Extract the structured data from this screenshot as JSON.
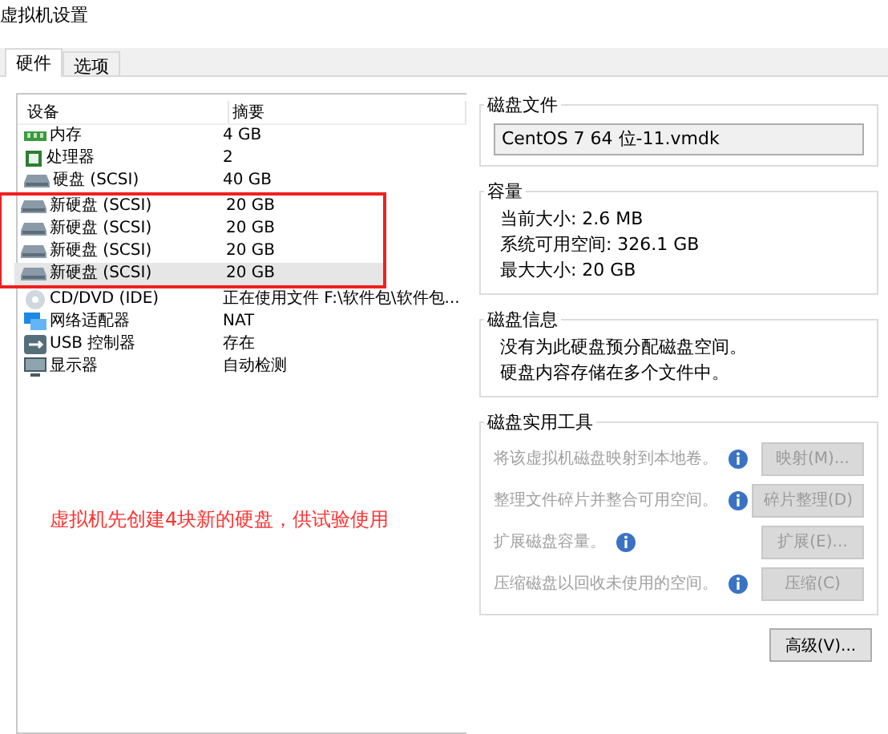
{
  "window": {
    "title": "虚拟机设置"
  },
  "tabs": [
    {
      "label": "硬件",
      "selected": true
    },
    {
      "label": "选项",
      "selected": false
    }
  ],
  "devices": {
    "columns": [
      "设备",
      "摘要"
    ],
    "rows": [
      {
        "kind": "memory",
        "name": "内存",
        "summary": "4 GB",
        "selected": false,
        "marked": false
      },
      {
        "kind": "cpu",
        "name": "处理器",
        "summary": "2",
        "selected": false,
        "marked": false
      },
      {
        "kind": "disk",
        "name": "硬盘 (SCSI)",
        "summary": "40 GB",
        "selected": false,
        "marked": false
      },
      {
        "kind": "disk",
        "name": "新硬盘 (SCSI)",
        "summary": "20 GB",
        "selected": false,
        "marked": true
      },
      {
        "kind": "disk",
        "name": "新硬盘 (SCSI)",
        "summary": "20 GB",
        "selected": false,
        "marked": true
      },
      {
        "kind": "disk",
        "name": "新硬盘 (SCSI)",
        "summary": "20 GB",
        "selected": false,
        "marked": true
      },
      {
        "kind": "disk",
        "name": "新硬盘 (SCSI)",
        "summary": "20 GB",
        "selected": true,
        "marked": true
      },
      {
        "kind": "cdrom",
        "name": "CD/DVD (IDE)",
        "summary": "正在使用文件 F:\\软件包\\软件包...",
        "selected": false,
        "marked": false
      },
      {
        "kind": "network",
        "name": "网络适配器",
        "summary": "NAT",
        "selected": false,
        "marked": false
      },
      {
        "kind": "usb",
        "name": "USB 控制器",
        "summary": "存在",
        "selected": false,
        "marked": false
      },
      {
        "kind": "display",
        "name": "显示器",
        "summary": "自动检测",
        "selected": false,
        "marked": false
      }
    ]
  },
  "annotation": "虚拟机先创建4块新的硬盘，供试验使用",
  "disk_file": {
    "title": "磁盘文件",
    "value": "CentOS 7 64 位-11.vmdk"
  },
  "capacity": {
    "title": "容量",
    "lines": [
      "当前大小: 2.6 MB",
      "系统可用空间: 326.1 GB",
      "最大大小: 20 GB"
    ]
  },
  "disk_info": {
    "title": "磁盘信息",
    "lines": [
      "没有为此硬盘预分配磁盘空间。",
      "硬盘内容存储在多个文件中。"
    ]
  },
  "utilities": {
    "title": "磁盘实用工具",
    "items": [
      {
        "text": "将该虚拟机磁盘映射到本地卷。",
        "button": "映射(M)...",
        "disabled": true
      },
      {
        "text": "整理文件碎片并整合可用空间。",
        "button": "碎片整理(D)",
        "disabled": true
      },
      {
        "text": "扩展磁盘容量。",
        "button": "扩展(E)...",
        "disabled": true
      },
      {
        "text": "压缩磁盘以回收未使用的空间。",
        "button": "压缩(C)",
        "disabled": true
      }
    ]
  },
  "advanced_button": "高级(V)..."
}
